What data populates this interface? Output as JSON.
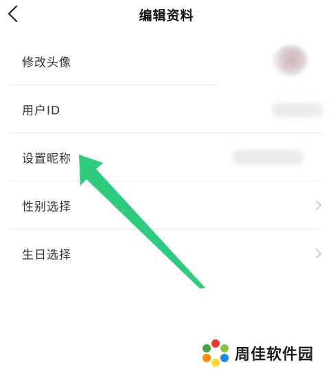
{
  "header": {
    "title": "编辑资料",
    "back_icon": "chevron-left-icon"
  },
  "rows": [
    {
      "label": "修改头像",
      "value_type": "avatar"
    },
    {
      "label": "用户ID",
      "value_type": "blurred"
    },
    {
      "label": "设置昵称",
      "value_type": "blurred"
    },
    {
      "label": "性别选择",
      "value_type": "chevron"
    },
    {
      "label": "生日选择",
      "value_type": "chevron"
    }
  ],
  "annotation": {
    "arrow_color": "#2ecb7f",
    "points_to": "设置昵称"
  },
  "watermark": {
    "text": "周佳软件园"
  },
  "colors": {
    "background": "#ffffff",
    "divider": "#ececec",
    "chevron": "#c4c4c4",
    "arrow": "#2ecb7f"
  }
}
